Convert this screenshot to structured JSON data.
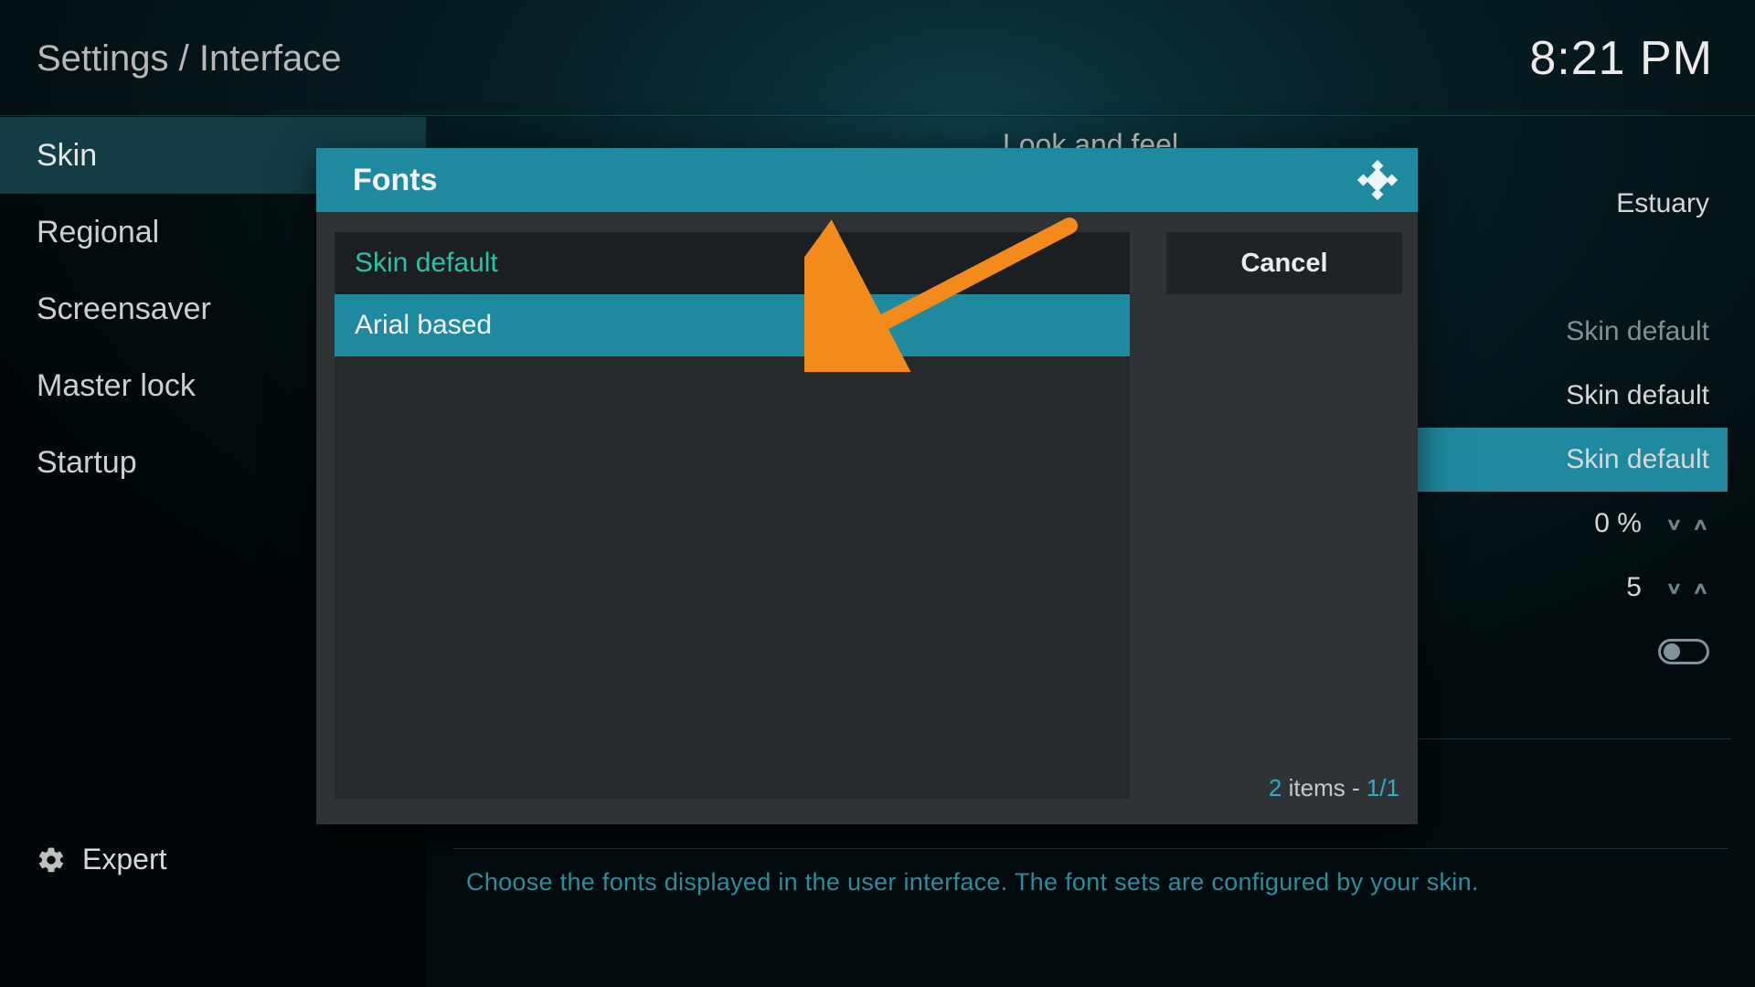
{
  "header": {
    "breadcrumb": "Settings / Interface",
    "clock": "8:21 PM"
  },
  "sidebar": {
    "items": [
      {
        "label": "Skin",
        "active": true
      },
      {
        "label": "Regional",
        "active": false
      },
      {
        "label": "Screensaver",
        "active": false
      },
      {
        "label": "Master lock",
        "active": false
      },
      {
        "label": "Startup",
        "active": false
      }
    ],
    "level_label": "Expert"
  },
  "main": {
    "section_title": "Look and feel",
    "rows": [
      {
        "value": "Estuary",
        "dim": false,
        "stepper": false,
        "toggle": false,
        "highlight": false
      },
      {
        "value": "",
        "dim": false,
        "stepper": false,
        "toggle": false,
        "highlight": false
      },
      {
        "value": "Skin default",
        "dim": true,
        "stepper": false,
        "toggle": false,
        "highlight": false
      },
      {
        "value": "Skin default",
        "dim": false,
        "stepper": false,
        "toggle": false,
        "highlight": false
      },
      {
        "value": "Skin default",
        "dim": false,
        "stepper": false,
        "toggle": false,
        "highlight": true
      },
      {
        "value": "0 %",
        "dim": false,
        "stepper": true,
        "toggle": false,
        "highlight": false
      },
      {
        "value": "5",
        "dim": false,
        "stepper": true,
        "toggle": false,
        "highlight": false
      },
      {
        "value": "",
        "dim": false,
        "stepper": false,
        "toggle": true,
        "highlight": false
      }
    ],
    "help_text": "Choose the fonts displayed in the user interface. The font sets are configured by your skin."
  },
  "modal": {
    "title": "Fonts",
    "options": [
      {
        "label": "Skin default",
        "state": "current"
      },
      {
        "label": "Arial based",
        "state": "selected"
      }
    ],
    "cancel_label": "Cancel",
    "status": {
      "count": "2",
      "items_word": " items - ",
      "page": "1/1"
    }
  }
}
